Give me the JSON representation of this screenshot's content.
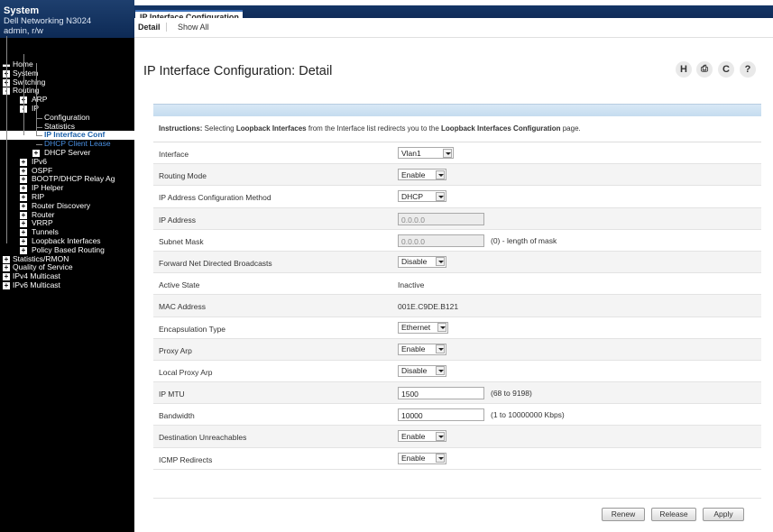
{
  "header": {
    "system_title": "System",
    "device_model": "Dell Networking N3024",
    "user": "admin, r/w"
  },
  "nav": {
    "items": [
      {
        "label": "Home",
        "level": 0,
        "icon": "home-icon"
      },
      {
        "label": "System",
        "level": 0,
        "expander": "+"
      },
      {
        "label": "Switching",
        "level": 0,
        "expander": "+"
      },
      {
        "label": "Routing",
        "level": 0,
        "expander": "-"
      },
      {
        "label": "ARP",
        "level": 1,
        "expander": "+"
      },
      {
        "label": "IP",
        "level": 1,
        "expander": "-"
      },
      {
        "label": "Configuration",
        "level": 2
      },
      {
        "label": "Statistics",
        "level": 2
      },
      {
        "label": "IP Interface Conf",
        "level": 2,
        "selected": true
      },
      {
        "label": "DHCP Client Lease",
        "level": 2
      },
      {
        "label": "DHCP Server",
        "level": 2,
        "expander": "+"
      },
      {
        "label": "IPv6",
        "level": 1,
        "expander": "+"
      },
      {
        "label": "OSPF",
        "level": 1,
        "expander": "+"
      },
      {
        "label": "BOOTP/DHCP Relay Ag",
        "level": 1,
        "expander": "+"
      },
      {
        "label": "IP Helper",
        "level": 1,
        "expander": "+"
      },
      {
        "label": "RIP",
        "level": 1,
        "expander": "+"
      },
      {
        "label": "Router Discovery",
        "level": 1,
        "expander": "+"
      },
      {
        "label": "Router",
        "level": 1,
        "expander": "+"
      },
      {
        "label": "VRRP",
        "level": 1,
        "expander": "+"
      },
      {
        "label": "Tunnels",
        "level": 1,
        "expander": "+"
      },
      {
        "label": "Loopback Interfaces",
        "level": 1,
        "expander": "+"
      },
      {
        "label": "Policy Based Routing",
        "level": 1,
        "expander": "+"
      },
      {
        "label": "Statistics/RMON",
        "level": 0,
        "expander": "+"
      },
      {
        "label": "Quality of Service",
        "level": 0,
        "expander": "+"
      },
      {
        "label": "IPv4 Multicast",
        "level": 0,
        "expander": "+"
      },
      {
        "label": "IPv6 Multicast",
        "level": 0,
        "expander": "+"
      }
    ]
  },
  "tabs": {
    "main": "IP Interface Configuration",
    "detail": "Detail",
    "show_all": "Show All"
  },
  "page": {
    "title": "IP Interface Configuration: Detail",
    "tools": {
      "help_h": "H",
      "print": "⎙",
      "refresh": "C",
      "question": "?"
    }
  },
  "instructions": {
    "prefix": "Instructions:",
    "text1": " Selecting ",
    "bold1": "Loopback Interfaces",
    "text2": " from the Interface list redirects you to the ",
    "bold2": "Loopback Interfaces Configuration",
    "text3": " page."
  },
  "form": {
    "interface": {
      "label": "Interface",
      "value": "Vlan1"
    },
    "routing_mode": {
      "label": "Routing Mode",
      "value": "Enable"
    },
    "ip_method": {
      "label": "IP Address Configuration Method",
      "value": "DHCP"
    },
    "ip_address": {
      "label": "IP Address",
      "value": "0.0.0.0"
    },
    "subnet_mask": {
      "label": "Subnet Mask",
      "value": "0.0.0.0",
      "hint": "(0) - length of mask"
    },
    "fwd_broadcasts": {
      "label": "Forward Net Directed Broadcasts",
      "value": "Disable"
    },
    "active_state": {
      "label": "Active State",
      "value": "Inactive"
    },
    "mac_address": {
      "label": "MAC Address",
      "value": "001E.C9DE.B121"
    },
    "encap_type": {
      "label": "Encapsulation Type",
      "value": "Ethernet"
    },
    "proxy_arp": {
      "label": "Proxy Arp",
      "value": "Enable"
    },
    "local_proxy_arp": {
      "label": "Local Proxy Arp",
      "value": "Disable"
    },
    "ip_mtu": {
      "label": "IP MTU",
      "value": "1500",
      "hint": "(68 to 9198)"
    },
    "bandwidth": {
      "label": "Bandwidth",
      "value": "10000",
      "hint": "(1 to 10000000 Kbps)"
    },
    "dest_unreach": {
      "label": "Destination Unreachables",
      "value": "Enable"
    },
    "icmp_redirects": {
      "label": "ICMP Redirects",
      "value": "Enable"
    }
  },
  "buttons": {
    "renew": "Renew",
    "release": "Release",
    "apply": "Apply"
  }
}
